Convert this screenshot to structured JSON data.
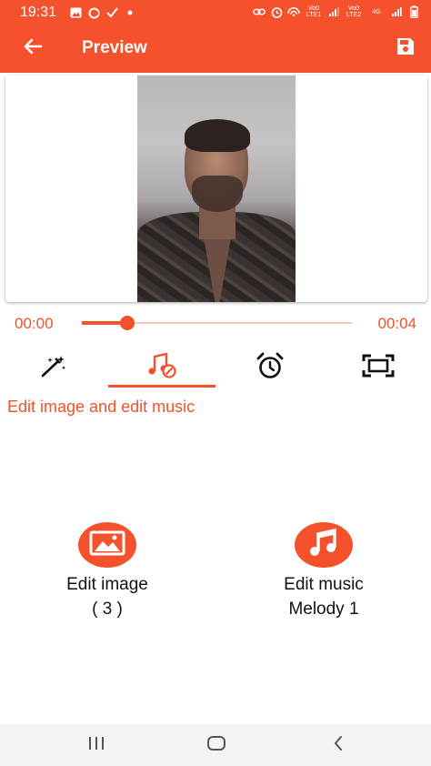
{
  "status_bar": {
    "time": "19:31",
    "left_icons": [
      "gallery-icon",
      "alt-icon",
      "check-icon",
      "dot-icon"
    ],
    "right_icons": [
      "link-icon",
      "alarm-icon",
      "hotspot-icon",
      "signal-icon",
      "signal-icon",
      "battery-icon"
    ],
    "network_labels": [
      "Vo0 LTE1",
      "Vo0 LTE2",
      "4G"
    ]
  },
  "app_bar": {
    "title": "Preview",
    "back_icon": "arrow-left-icon",
    "save_icon": "save-icon"
  },
  "player": {
    "current_time": "00:00",
    "total_time": "00:04",
    "progress": 0.17
  },
  "tabs": [
    {
      "icon": "magic-wand-icon",
      "selected": false
    },
    {
      "icon": "music-edit-icon",
      "selected": true
    },
    {
      "icon": "alarm-clock-icon",
      "selected": false
    },
    {
      "icon": "frame-icon",
      "selected": false
    }
  ],
  "edit_heading": "Edit image and edit music",
  "actions": {
    "edit_image": {
      "label": "Edit image",
      "sub": "( 3 )",
      "icon": "image-icon"
    },
    "edit_music": {
      "label": "Edit music",
      "sub": "Melody 1",
      "icon": "music-note-icon"
    }
  },
  "nav_bar": {
    "recents_icon": "recents-icon",
    "home_icon": "home-icon",
    "back_icon": "back-icon"
  },
  "colors": {
    "accent": "#f4512c",
    "track_light": "#f7c6b8",
    "nav_background": "#f4f4f4"
  }
}
